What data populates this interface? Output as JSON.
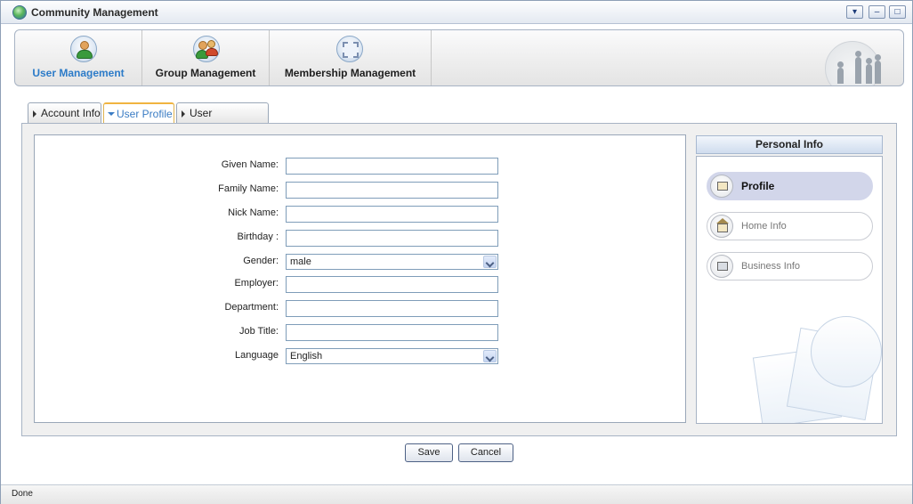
{
  "window": {
    "title": "Community Management",
    "controls": {
      "menu": "▾",
      "minimize": "–",
      "maximize": "□"
    }
  },
  "navbar": {
    "items": [
      {
        "label": "User Management",
        "icon": "user-icon",
        "active": true
      },
      {
        "label": "Group Management",
        "icon": "group-icon",
        "active": false
      },
      {
        "label": "Membership Management",
        "icon": "membership-icon",
        "active": false
      }
    ]
  },
  "tabs": [
    {
      "label": "Account Info",
      "active": false
    },
    {
      "label": "User Profile",
      "active": true
    },
    {
      "label": "User Membership",
      "active": false
    }
  ],
  "form": {
    "fields": [
      {
        "label": "Given Name:",
        "type": "text",
        "value": ""
      },
      {
        "label": "Family Name:",
        "type": "text",
        "value": ""
      },
      {
        "label": "Nick Name:",
        "type": "text",
        "value": ""
      },
      {
        "label": "Birthday :",
        "type": "text",
        "value": ""
      },
      {
        "label": "Gender:",
        "type": "select",
        "value": "male"
      },
      {
        "label": "Employer:",
        "type": "text",
        "value": ""
      },
      {
        "label": "Department:",
        "type": "text",
        "value": ""
      },
      {
        "label": "Job Title:",
        "type": "text",
        "value": ""
      },
      {
        "label": "Language",
        "type": "select",
        "value": "English"
      }
    ]
  },
  "side_panel": {
    "title": "Personal Info",
    "items": [
      {
        "label": "Profile",
        "icon": "profile-card-icon",
        "active": true
      },
      {
        "label": "Home Info",
        "icon": "home-icon",
        "active": false
      },
      {
        "label": "Business Info",
        "icon": "briefcase-icon",
        "active": false
      }
    ]
  },
  "buttons": {
    "save": "Save",
    "cancel": "Cancel"
  },
  "status": {
    "text": "Done"
  },
  "colors": {
    "active_nav": "#2c7bc8",
    "active_tab_text": "#3a7cc4",
    "active_side_item": "#d2d6ea",
    "tab_highlight": "#f0b440"
  }
}
